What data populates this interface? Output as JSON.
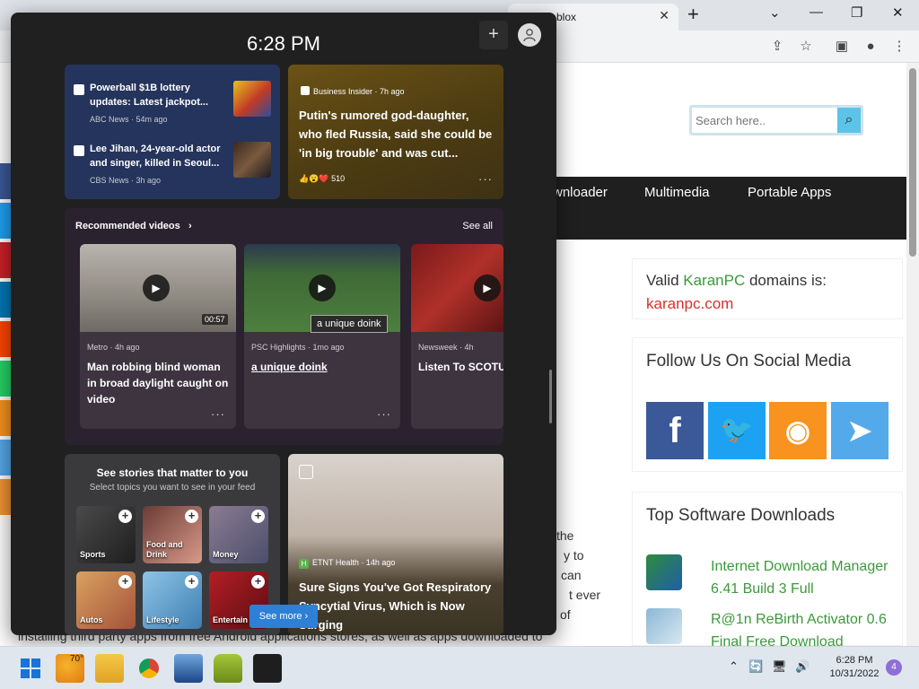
{
  "browser": {
    "tab_title": "blox",
    "tab_close": "✕",
    "new_tab": "+",
    "controls": [
      "⌄",
      "—",
      "❐",
      "✕"
    ]
  },
  "site": {
    "search_placeholder": "Search here..",
    "nav": [
      "wnloader",
      "Multimedia",
      "Portable Apps"
    ],
    "valid_prefix": "Valid ",
    "valid_brand": "KaranPC",
    "valid_suffix": " domains is:",
    "valid_domain": "karanpc.com",
    "follow_title": "Follow Us On Social Media",
    "social": [
      {
        "name": "facebook",
        "glyph": "f",
        "color": "#3b5998"
      },
      {
        "name": "twitter",
        "glyph": "🐦",
        "color": "#1da1f2"
      },
      {
        "name": "rss",
        "glyph": "◉",
        "color": "#f7931e"
      },
      {
        "name": "telegram",
        "glyph": "➤",
        "color": "#54a9eb"
      }
    ],
    "top_title": "Top Software Downloads",
    "downloads": [
      {
        "title": "Internet Download Manager 6.41 Build 3 Full"
      },
      {
        "title": "R@1n ReBirth Activator 0.6 Final Free Download"
      }
    ],
    "article_lines": [
      "the",
      "y to",
      "can",
      "t ever",
      "of"
    ],
    "bottom_line": "installing third party apps from free Android applications stores, as well as apps downloaded to"
  },
  "widgets": {
    "time": "6:28 PM",
    "add_label": "+",
    "news": [
      {
        "title": "Powerball $1B lottery updates: Latest jackpot...",
        "meta": "ABC News · 54m ago"
      },
      {
        "title": "Lee Jihan, 24-year-old actor and singer, killed in Seoul...",
        "meta": "CBS News · 3h ago"
      }
    ],
    "bi": {
      "source": "Business Insider · 7h ago",
      "title": "Putin's rumored god-daughter, who fled Russia, said she could be 'in big trouble' and was cut...",
      "reactions": "👍😮❤️ 510",
      "more": "···"
    },
    "videos": {
      "title": "Recommended videos",
      "chevron": "›",
      "see_all": "See all",
      "items": [
        {
          "source": "Metro · 4h ago",
          "title": "Man robbing blind woman in broad daylight caught on video",
          "duration": "00:57",
          "more": "···"
        },
        {
          "source": "PSC Highlights · 1mo ago",
          "title": "a unique doink",
          "more": "···"
        },
        {
          "source": "Newsweek · 4h",
          "title": "Listen To SCOTUS Jackson Confi In Affirmative"
        }
      ],
      "tooltip": "a unique doink",
      "play": "▶"
    },
    "topics": {
      "title": "See stories that matter to you",
      "subtitle": "Select topics you want to see in your feed",
      "items": [
        "Sports",
        "Food and Drink",
        "Money",
        "Autos",
        "Lifestyle",
        "Entertain"
      ],
      "plus": "+"
    },
    "see_more": "See more ›",
    "rsv": {
      "source": "ETNT Health · 14h ago",
      "logo": "H",
      "title": "Sure Signs You've Got Respiratory Syncytial Virus, Which is Now Surging"
    }
  },
  "taskbar": {
    "temp": "70°",
    "time": "6:28 PM",
    "date": "10/31/2022",
    "notifications": "4",
    "tray": [
      "⌃",
      "🔄",
      "🖥",
      "🔊"
    ]
  }
}
